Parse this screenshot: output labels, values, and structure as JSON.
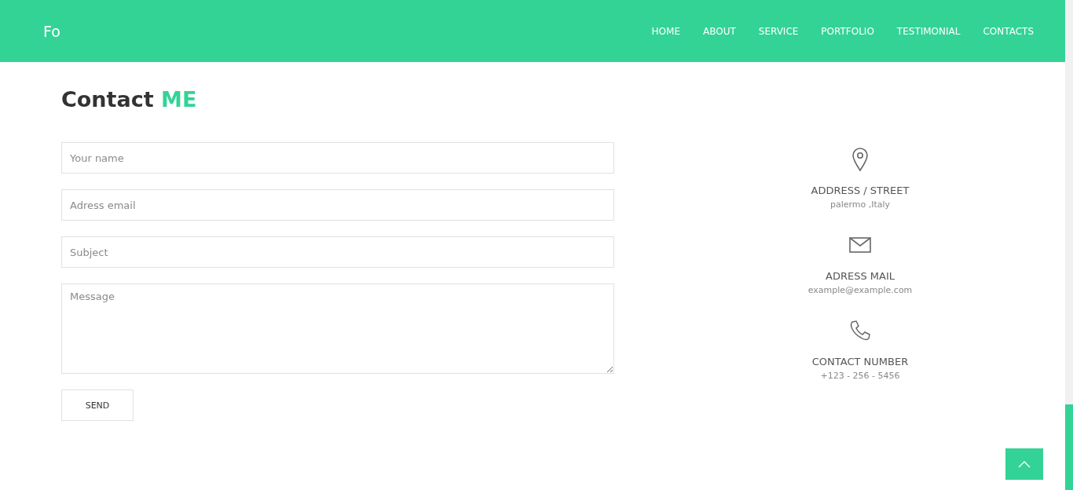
{
  "header": {
    "logo": "Fo",
    "nav": [
      {
        "label": "HOME"
      },
      {
        "label": "ABOUT"
      },
      {
        "label": "SERVICE"
      },
      {
        "label": "PORTFOLIO"
      },
      {
        "label": "TESTIMONIAL"
      },
      {
        "label": "CONTACTS"
      }
    ]
  },
  "heading": {
    "text": "Contact",
    "accent": "ME"
  },
  "form": {
    "fields": [
      {
        "kind": "input",
        "placeholder": "Your name"
      },
      {
        "kind": "input",
        "placeholder": "Adress email"
      },
      {
        "kind": "input",
        "placeholder": "Subject"
      },
      {
        "kind": "textarea",
        "placeholder": "Message"
      }
    ],
    "button": "SEND"
  },
  "contact_info": [
    {
      "kind": "pin",
      "title": "ADDRESS / STREET",
      "value": "palermo ,Italy"
    },
    {
      "kind": "mail",
      "title": "ADRESS MAIL",
      "value": "example@example.com"
    },
    {
      "kind": "phone",
      "title": "CONTACT NUMBER",
      "value": "+123 - 256 - 5456"
    }
  ]
}
